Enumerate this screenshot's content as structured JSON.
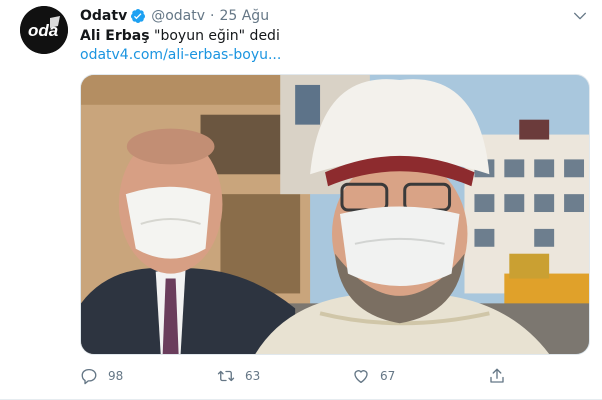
{
  "tweet": {
    "name": "Odatv",
    "handle": "@odatv",
    "separator": "·",
    "time": "25 Ağu",
    "text_bold": "Ali Erbaş",
    "text_rest": " \"boyun eğin\" dedi",
    "link": "odatv4.com/ali-erbas-boyu...",
    "icons": {
      "avatar": "odatv-logo",
      "verified": "verified-badge-icon",
      "more": "chevron-down-icon",
      "reply": "reply-icon",
      "retweet": "retweet-icon",
      "like": "heart-icon",
      "share": "share-icon"
    },
    "media": {
      "alt": "photo of two men wearing face masks outdoors"
    },
    "stats": {
      "replies": "98",
      "retweets": "63",
      "likes": "67"
    },
    "colors": {
      "accent": "#1da1f2",
      "link": "#1b95e0",
      "muted": "#657786"
    }
  }
}
